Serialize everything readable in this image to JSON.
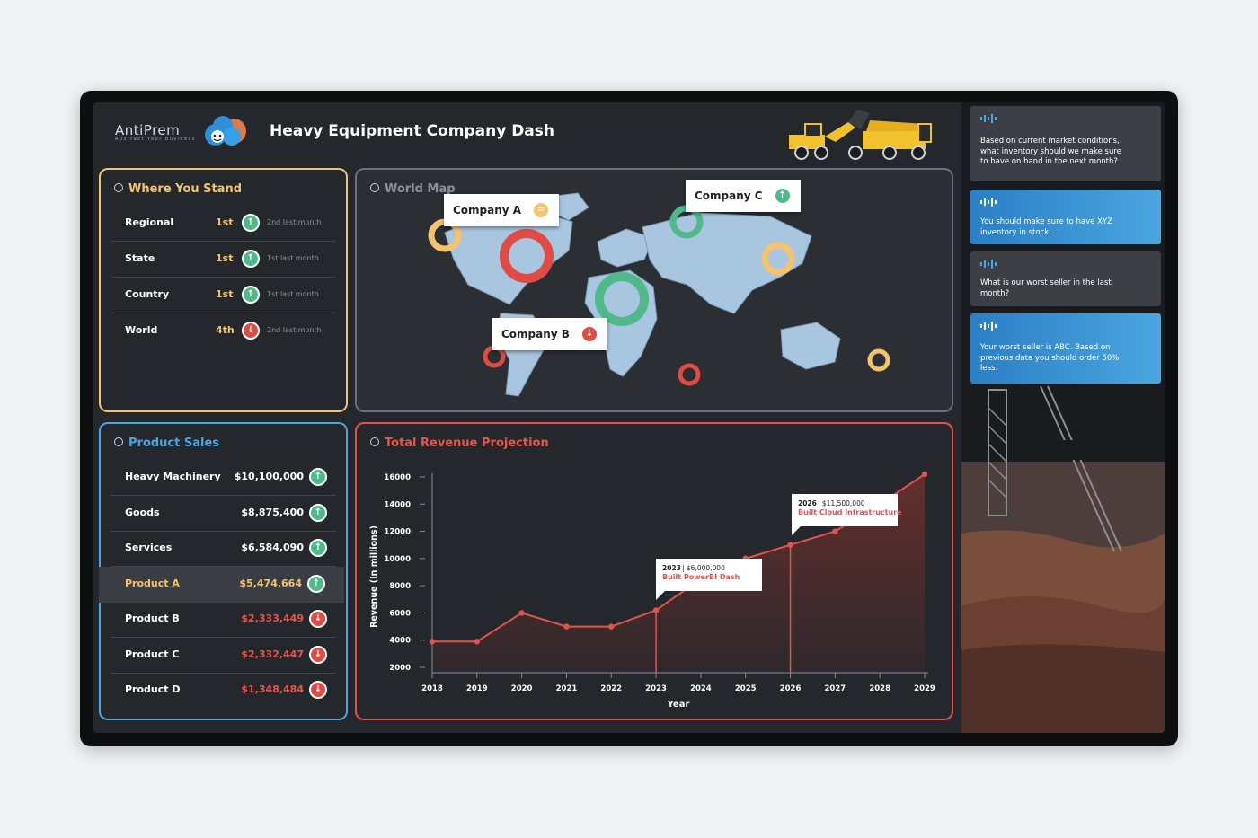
{
  "header": {
    "logo_text": "AntiPrem",
    "logo_tagline": "Abstract Your Business",
    "title": "Heavy Equipment Company Dash"
  },
  "where_you_stand": {
    "title": "Where You Stand",
    "rows": [
      {
        "label": "Regional",
        "rank": "1st",
        "trend": "up",
        "note": "2nd last month"
      },
      {
        "label": "State",
        "rank": "1st",
        "trend": "up",
        "note": "1st last month"
      },
      {
        "label": "Country",
        "rank": "1st",
        "trend": "up",
        "note": "1st last month"
      },
      {
        "label": "World",
        "rank": "4th",
        "trend": "down",
        "note": "2nd last month"
      }
    ]
  },
  "product_sales": {
    "title": "Product Sales",
    "rows": [
      {
        "label": "Heavy Machinery",
        "value": "$10,100,000",
        "trend": "up"
      },
      {
        "label": "Goods",
        "value": "$8,875,400",
        "trend": "up"
      },
      {
        "label": "Services",
        "value": "$6,584,090",
        "trend": "up"
      },
      {
        "label": "Product A",
        "value": "$5,474,664",
        "trend": "up"
      },
      {
        "label": "Product B",
        "value": "$2,333,449",
        "trend": "down"
      },
      {
        "label": "Product C",
        "value": "$2,332,447",
        "trend": "down"
      },
      {
        "label": "Product D",
        "value": "$1,348,484",
        "trend": "down"
      }
    ]
  },
  "world_map": {
    "title": "World Map",
    "companies": [
      {
        "name": "Company A",
        "trend": "eq"
      },
      {
        "name": "Company B",
        "trend": "down"
      },
      {
        "name": "Company C",
        "trend": "up"
      }
    ],
    "colors": {
      "land": "#a9c6e0",
      "ring_red": "#e04b44",
      "ring_green": "#4fb98a",
      "ring_yellow": "#f2c46d"
    }
  },
  "chat": [
    {
      "role": "question",
      "text": "Based on current market conditions, what inventory should we make sure to have on hand in the next month?"
    },
    {
      "role": "answer",
      "text": "You should make sure to have XYZ inventory in stock."
    },
    {
      "role": "question",
      "text": "What is our worst seller in the last month?"
    },
    {
      "role": "answer",
      "text": "Your worst seller is ABC. Based on previous data you should order 50% less."
    }
  ],
  "chart_data": {
    "type": "area",
    "title": "Total Revenue Projection",
    "xlabel": "Year",
    "ylabel": "Revenue (In millions)",
    "x": [
      2018,
      2019,
      2020,
      2021,
      2022,
      2023,
      2024,
      2025,
      2026,
      2027,
      2028,
      2029
    ],
    "values": [
      3900,
      3900,
      6000,
      5000,
      5000,
      6200,
      8500,
      10000,
      11000,
      12000,
      14000,
      16200
    ],
    "ylim": [
      2000,
      16000
    ],
    "yticks": [
      2000,
      4000,
      6000,
      8000,
      10000,
      12000,
      14000,
      16000
    ],
    "annotations": [
      {
        "year": "2023",
        "amount": "$6,000,000",
        "label": "Built PowerBI Dash"
      },
      {
        "year": "2026",
        "amount": "$11,500,000",
        "label": "Built Cloud Infrastructure"
      }
    ],
    "colors": {
      "line": "#e0544d",
      "area": "#6b2f2c"
    }
  }
}
